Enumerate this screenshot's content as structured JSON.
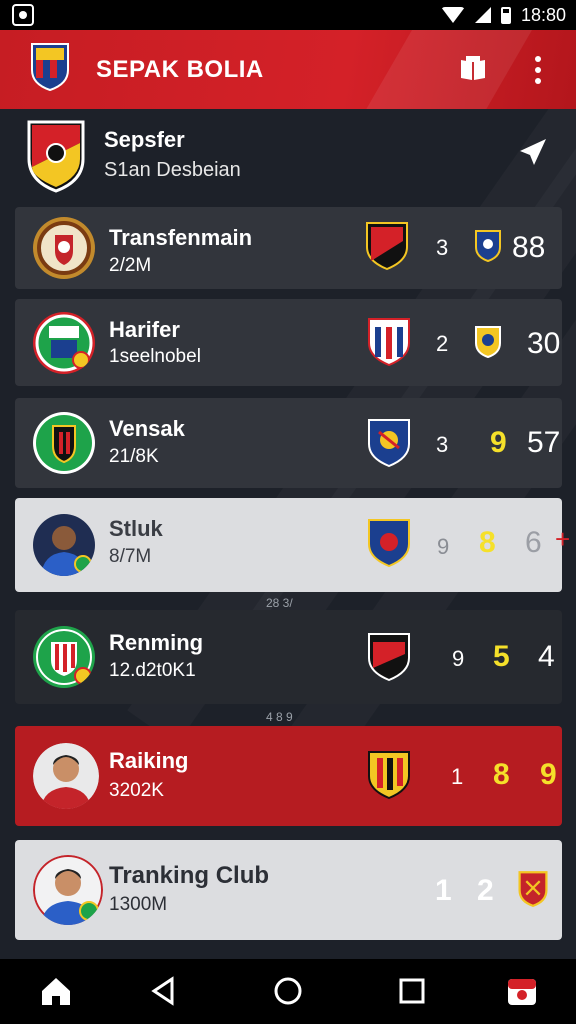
{
  "status": {
    "time": "18:80"
  },
  "appbar": {
    "title": "SEPAK BOLIA",
    "icons": [
      "club-crest-icon",
      "book-icon",
      "more-vert-icon"
    ]
  },
  "team": {
    "name": "Sepsfer",
    "subtitle": "S1an Desbeian",
    "icon": "send-icon"
  },
  "rows": [
    {
      "title": "Transfenmain",
      "sub": "2/2M",
      "num": "3",
      "score": "88",
      "score_color": "#ffffff"
    },
    {
      "title": "Harifer",
      "sub": "1seelnobel",
      "num": "2",
      "score": "30",
      "score_color": "#ffffff"
    },
    {
      "title": "Vensak",
      "sub": "21/8K",
      "num": "3",
      "score_a": "9",
      "score_b": "57"
    },
    {
      "title": "Stluk",
      "sub": "8/7M",
      "num": "9",
      "score_a": "8",
      "score_b": "6",
      "marker": "+"
    },
    {
      "title": "Renming",
      "sub": "12.d2t0K1",
      "num": "9",
      "score_a": "5",
      "score_b": "4"
    },
    {
      "title": "Raiking",
      "sub": "3202K",
      "num": "1",
      "score_a": "8",
      "score_b": "9"
    },
    {
      "title": "Tranking Club",
      "sub": "1300M",
      "num_a": "1",
      "num_b": "2"
    }
  ],
  "separators": [
    "28 3/",
    "4 8 9"
  ],
  "colors": {
    "accent_red": "#c61d23",
    "highlight_yellow": "#f5e02a"
  },
  "nav": [
    "home-icon",
    "back-icon",
    "circle-home-icon",
    "recents-icon",
    "app-icon"
  ]
}
